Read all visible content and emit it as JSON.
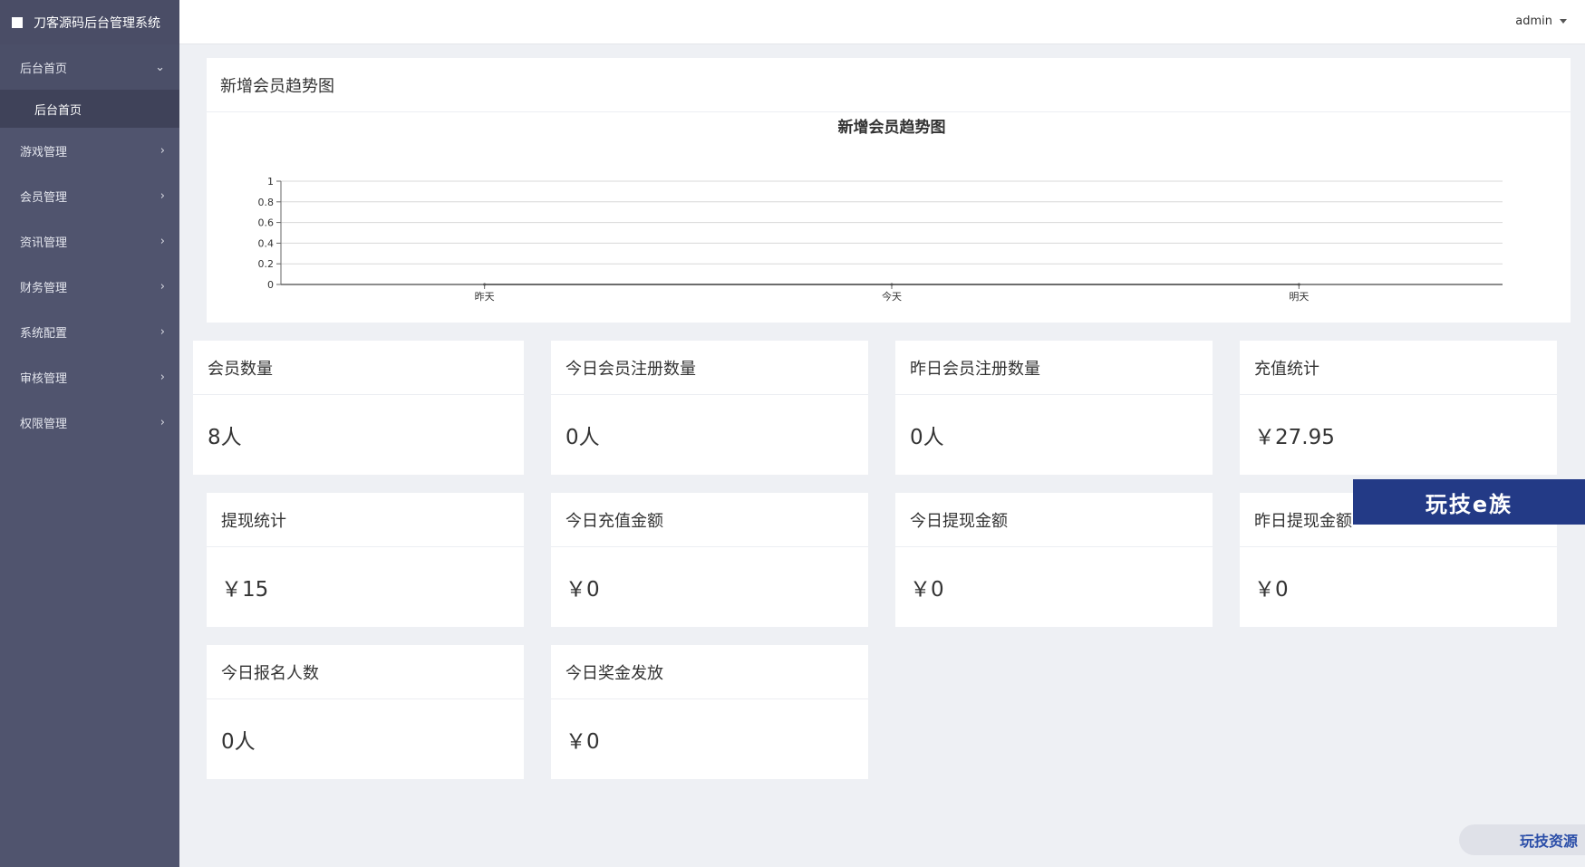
{
  "app": {
    "title": "刀客源码后台管理系统"
  },
  "header": {
    "user": "admin"
  },
  "sidebar": {
    "items": [
      {
        "label": "后台首页",
        "chevron": "⌄",
        "open": true,
        "sub": [
          "后台首页"
        ]
      },
      {
        "label": "游戏管理",
        "chevron": "›"
      },
      {
        "label": "会员管理",
        "chevron": "›"
      },
      {
        "label": "资讯管理",
        "chevron": "›"
      },
      {
        "label": "财务管理",
        "chevron": "›"
      },
      {
        "label": "系统配置",
        "chevron": "›"
      },
      {
        "label": "审核管理",
        "chevron": "›"
      },
      {
        "label": "权限管理",
        "chevron": "›"
      }
    ]
  },
  "chart_panel": {
    "title": "新增会员趋势图"
  },
  "chart_data": {
    "type": "line",
    "title": "新增会员趋势图",
    "categories": [
      "昨天",
      "今天",
      "明天"
    ],
    "ylim": [
      0,
      1
    ],
    "yticks": [
      "0",
      "0.2",
      "0.4",
      "0.6",
      "0.8",
      "1"
    ],
    "grid": true,
    "series": [
      {
        "values": [
          0,
          0,
          0
        ]
      }
    ]
  },
  "cards": [
    {
      "title": "会员数量",
      "value": "8人"
    },
    {
      "title": "今日会员注册数量",
      "value": "0人"
    },
    {
      "title": "昨日会员注册数量",
      "value": "0人"
    },
    {
      "title": "充值统计",
      "value": "￥27.95"
    },
    {
      "title": "提现统计",
      "value": "￥15"
    },
    {
      "title": "今日充值金额",
      "value": "￥0"
    },
    {
      "title": "今日提现金额",
      "value": "￥0"
    },
    {
      "title": "昨日提现金额",
      "value": "￥0"
    },
    {
      "title": "今日报名人数",
      "value": "0人"
    },
    {
      "title": "今日奖金发放",
      "value": "￥0"
    }
  ],
  "watermarks": {
    "banner": "玩技e族",
    "badge": "玩技资源"
  },
  "colors": {
    "sidebar": "#50546e",
    "banner": "#233a86"
  }
}
